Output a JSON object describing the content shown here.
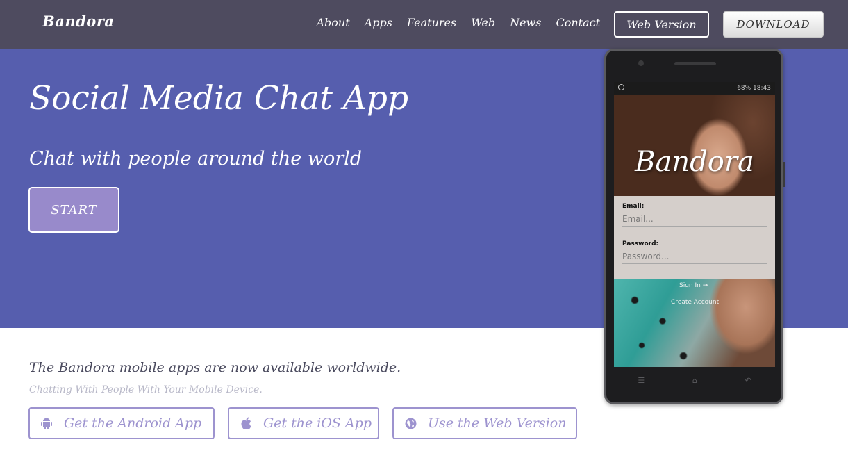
{
  "navbar": {
    "brand": "Bandora",
    "links": [
      "About",
      "Apps",
      "Features",
      "Web",
      "News",
      "Contact"
    ],
    "web_version_label": "Web Version",
    "download_label": "DOWNLOAD"
  },
  "hero": {
    "title": "Social Media Chat App",
    "subtitle": "Chat with people around the world",
    "start_label": "START"
  },
  "availability": {
    "headline": "The Bandora mobile apps are now available worldwide.",
    "subline": "Chatting With People With Your Mobile Device.",
    "buttons": {
      "android": "Get the Android App",
      "ios": "Get the iOS App",
      "web": "Use the Web Version"
    }
  },
  "phone": {
    "status": "68%  18:43",
    "app_name": "Bandora",
    "email_label": "Email:",
    "email_placeholder": "Email...",
    "password_label": "Password:",
    "password_placeholder": "Password...",
    "sign_in": "Sign In →",
    "create_account": "Create Account"
  },
  "colors": {
    "navbar": "#4e4b5f",
    "hero": "#565eae",
    "accent": "#9d93cf",
    "start_button": "#988acb"
  },
  "icons": [
    "android-icon",
    "apple-icon",
    "globe-icon"
  ]
}
